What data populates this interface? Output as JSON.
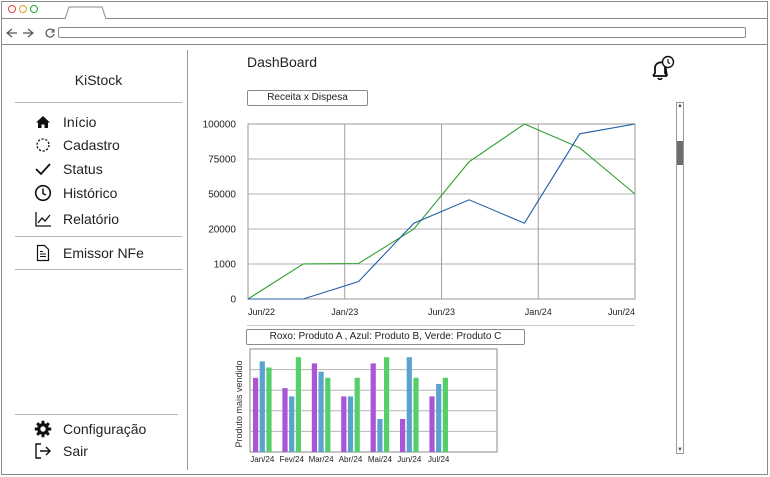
{
  "app": {
    "name": "KiStock",
    "page_title": "DashBoard"
  },
  "sidebar": {
    "items": [
      {
        "label": "Início",
        "icon": "home-icon"
      },
      {
        "label": "Cadastro",
        "icon": "circle-dashed-icon"
      },
      {
        "label": "Status",
        "icon": "check-icon"
      },
      {
        "label": "Histórico",
        "icon": "clock-icon"
      },
      {
        "label": "Relatório",
        "icon": "line-chart-icon"
      }
    ],
    "secondary": [
      {
        "label": "Emissor NFe",
        "icon": "document-icon"
      }
    ],
    "footer": [
      {
        "label": "Configuração",
        "icon": "gear-icon"
      },
      {
        "label": "Sair",
        "icon": "logout-icon"
      }
    ]
  },
  "main": {
    "chart1_button": "Receita x Dispesa",
    "chart2_button": "Roxo: Produto A , Azul: Produto B, Verde: Produto C"
  },
  "colors": {
    "green": "#2ca02c",
    "blue": "#1f5fa8",
    "purple": "#a855d6",
    "bar_blue": "#5ba3cf",
    "bar_green": "#55cf6a"
  },
  "chart_data": [
    {
      "type": "line",
      "x_ticks": [
        "Jun/22",
        "Jan/23",
        "Jun/23",
        "Jan/24",
        "Jun/24"
      ],
      "y_ticks": [
        "0",
        "1000",
        "20000",
        "50000",
        "75000",
        "100000"
      ],
      "series": [
        {
          "color": "#2ca02c",
          "values": [
            0,
            1050,
            1250,
            20000,
            73000,
            100000,
            83000,
            50000
          ]
        },
        {
          "color": "#1f5fa8",
          "values": [
            0,
            0,
            500,
            25000,
            45000,
            25000,
            93000,
            100000
          ]
        }
      ],
      "grid": true
    },
    {
      "type": "bar",
      "ylabel": "Produto mais vendido",
      "categories": [
        "Jan/24",
        "Fev/24",
        "Mar/24",
        "Abr/24",
        "Mai/24",
        "Jun/24",
        "Jul/24"
      ],
      "series": [
        {
          "color": "#a855d6",
          "values": [
            3.6,
            3.1,
            4.3,
            2.7,
            4.3,
            1.6,
            2.7
          ]
        },
        {
          "color": "#5ba3cf",
          "values": [
            4.4,
            2.7,
            3.9,
            2.7,
            1.6,
            4.6,
            3.3
          ]
        },
        {
          "color": "#55cf6a",
          "values": [
            4.1,
            4.6,
            3.6,
            3.6,
            4.6,
            3.6,
            3.6
          ]
        }
      ],
      "ylim": [
        0,
        5
      ],
      "grid": true
    }
  ]
}
